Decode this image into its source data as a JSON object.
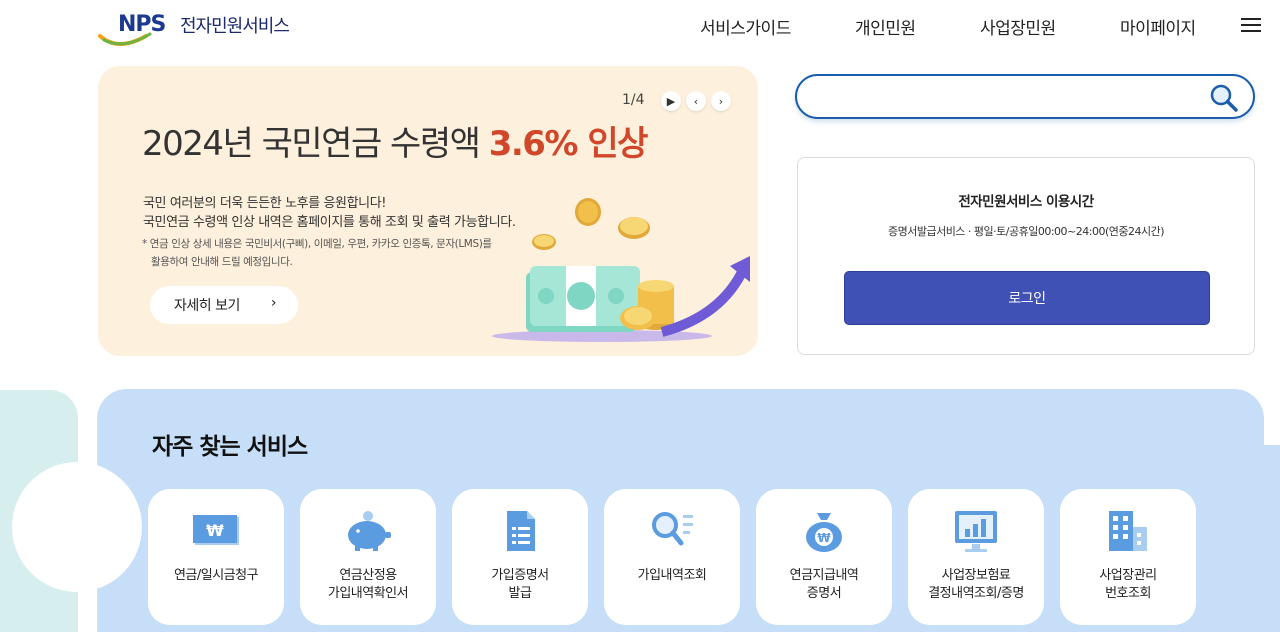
{
  "header": {
    "logo_mark": "NPS",
    "logo_title": "전자민원서비스",
    "nav": [
      "서비스가이드",
      "개인민원",
      "사업장민원",
      "마이페이지"
    ],
    "menu_icon": "hamburger-menu-icon"
  },
  "banner": {
    "pager": "1/4",
    "title_prefix": "2024년 국민연금 수령액 ",
    "title_highlight": "3.6% 인상",
    "desc_line1": "국민 여러분의 더욱 든든한 노후를 응원합니다!",
    "desc_line2": "국민연금 수령액 인상 내역은 홈페이지를 통해 조회 및 출력 가능합니다.",
    "note_line1": "* 연금 인상 상세 내용은 국민비서(구삐), 이메일, 우편, 카카오 인증톡, 문자(LMS)를",
    "note_line2": "활용하여 안내해 드릴 예정입니다.",
    "detail_button": "자세히 보기",
    "highlight_color": "#d0472a"
  },
  "search": {
    "value": "",
    "placeholder": ""
  },
  "service_time": {
    "title": "전자민원서비스 이용시간",
    "desc": "증명서발급서비스 · 평일·토/공휴일00:00~24:00(연중24시간)",
    "login_button": "로그인",
    "login_color": "#3f51b5"
  },
  "frequent": {
    "title": "자주 찾는 서비스",
    "items": [
      {
        "line1": "연금/일시금청구",
        "line2": "",
        "icon": "won-bill-icon"
      },
      {
        "line1": "연금산정용",
        "line2": "가입내역확인서",
        "icon": "piggy-bank-icon"
      },
      {
        "line1": "가입증명서",
        "line2": "발급",
        "icon": "document-icon"
      },
      {
        "line1": "가입내역조회",
        "line2": "",
        "icon": "search-list-icon"
      },
      {
        "line1": "연금지급내역",
        "line2": "증명서",
        "icon": "money-bag-icon"
      },
      {
        "line1": "사업장보험료",
        "line2": "결정내역조회/증명",
        "icon": "chart-monitor-icon"
      },
      {
        "line1": "사업장관리",
        "line2": "번호조회",
        "icon": "building-icon"
      }
    ]
  }
}
